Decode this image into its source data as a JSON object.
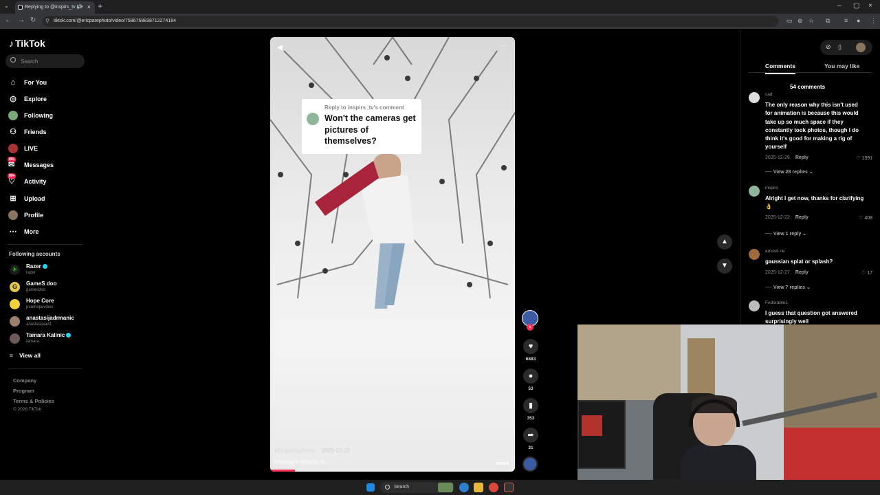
{
  "browser": {
    "tab_title": "Replying to @inspirs_tv Ne",
    "url": "tiktok.com/@ericparephoto/video/7586758838712274184"
  },
  "sidebar": {
    "logo": "TikTok",
    "search_placeholder": "Search",
    "nav": [
      {
        "label": "For You",
        "icon": "home-icon"
      },
      {
        "label": "Explore",
        "icon": "compass-icon"
      },
      {
        "label": "Following",
        "icon": "following-avatar-icon"
      },
      {
        "label": "Friends",
        "icon": "friends-icon"
      },
      {
        "label": "LIVE",
        "icon": "live-icon"
      },
      {
        "label": "Messages",
        "icon": "messages-icon",
        "badge": "99+"
      },
      {
        "label": "Activity",
        "icon": "activity-icon",
        "badge": "99+"
      },
      {
        "label": "Upload",
        "icon": "upload-icon"
      },
      {
        "label": "Profile",
        "icon": "profile-avatar-icon"
      },
      {
        "label": "More",
        "icon": "more-icon"
      }
    ],
    "following_heading": "Following accounts",
    "accounts": [
      {
        "name": "Razer",
        "handle": "razer",
        "verified": true
      },
      {
        "name": "GameS doo",
        "handle": "gamesdoo",
        "verified": false
      },
      {
        "name": "Hope Core",
        "handle": "purehopevibes",
        "verified": false
      },
      {
        "name": "anastasijadrmanic",
        "handle": "anastasijaad1",
        "verified": false
      },
      {
        "name": "Tamara Kalinic",
        "handle": "tamara",
        "verified": true
      }
    ],
    "view_all": "View all",
    "footer": [
      "Company",
      "Program",
      "Terms & Policies",
      "© 2026 TikTok"
    ]
  },
  "video": {
    "reply_to": "Reply to inspirs_tv's comment",
    "question": "Won't the cameras get pictures of themselves?",
    "author": "ericparephoto",
    "date": "2025-12-22",
    "caption": "Replying to @inspirs_tv ...",
    "more": "more",
    "progress_fraction": 0.1
  },
  "actions": {
    "likes": "6883",
    "comments": "53",
    "saves": "353",
    "shares": "31"
  },
  "panel": {
    "tab_comments": "Comments",
    "tab_you_may_like": "You may like",
    "comment_count": "54 comments",
    "comments": [
      {
        "user": "cad",
        "text": "The only reason why this isn't used for animation is because this would take up so much space if they constantly took photos, though I do think it's good for making a rig of yourself",
        "date": "2025-12-28",
        "reply": "Reply",
        "likes": "1391",
        "replies": "View 28 replies"
      },
      {
        "user": "inspirs",
        "text": "Alright I get now, thanks for clarifying 👌",
        "date": "2025-12-22",
        "reply": "Reply",
        "likes": "408",
        "replies": "View 1 reply"
      },
      {
        "user": "arnosti ne",
        "text": "gaussian splat or splash?",
        "date": "2025-12-27",
        "reply": "Reply",
        "likes": "17",
        "replies": "View 7 replies"
      },
      {
        "user": "Fedorable1",
        "text": "I guess that question got answered surprisingly well"
      }
    ]
  },
  "taskbar": {
    "search": "Search"
  },
  "colors": {
    "accent": "#fe2c55",
    "verified": "#20d5ec"
  }
}
